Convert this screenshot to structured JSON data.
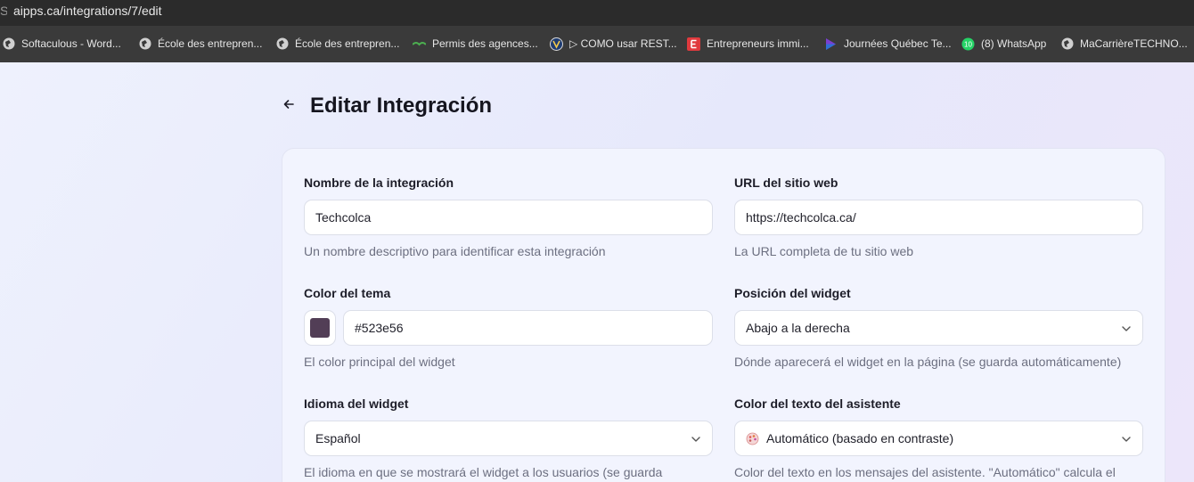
{
  "browser": {
    "url": "aipps.ca/integrations/7/edit",
    "url_lead": "S",
    "bookmarks": [
      {
        "label": "Softaculous - Word...",
        "icon": "globe-icon"
      },
      {
        "label": "École des entrepren...",
        "icon": "globe-icon"
      },
      {
        "label": "École des entrepren...",
        "icon": "globe-icon"
      },
      {
        "label": "Permis des agences...",
        "icon": "gov-logo-icon"
      },
      {
        "label": "▷ COMO usar REST...",
        "icon": "site-logo-icon"
      },
      {
        "label": "Entrepreneurs immi...",
        "icon": "e-logo-icon"
      },
      {
        "label": "Journées Québec Te...",
        "icon": "play-logo-icon"
      },
      {
        "label": "(8) WhatsApp",
        "icon": "whatsapp-icon",
        "badge": "10"
      },
      {
        "label": "MaCarrièreTECHNO...",
        "icon": "globe-icon"
      }
    ]
  },
  "page": {
    "title": "Editar Integración"
  },
  "form": {
    "name": {
      "label": "Nombre de la integración",
      "value": "Techcolca",
      "help": "Un nombre descriptivo para identificar esta integración"
    },
    "url": {
      "label": "URL del sitio web",
      "value": "https://techcolca.ca/",
      "help": "La URL completa de tu sitio web"
    },
    "theme_color": {
      "label": "Color del tema",
      "value": "#523e56",
      "swatch": "#523e56",
      "help": "El color principal del widget"
    },
    "position": {
      "label": "Posición del widget",
      "value": "Abajo a la derecha",
      "help": "Dónde aparecerá el widget en la página (se guarda automáticamente)"
    },
    "language": {
      "label": "Idioma del widget",
      "value": "Español",
      "help": "El idioma en que se mostrará el widget a los usuarios (se guarda"
    },
    "text_color": {
      "label": "Color del texto del asistente",
      "value": "Automático (basado en contraste)",
      "help": "Color del texto en los mensajes del asistente. \"Automático\" calcula el"
    }
  },
  "colors": {
    "chrome_top": "#2b2b2b",
    "chrome_bookmarks": "#3a3a3a",
    "card_bg": "#f2f4fe",
    "whatsapp": "#25d366",
    "e_logo": "#e03a3e"
  }
}
